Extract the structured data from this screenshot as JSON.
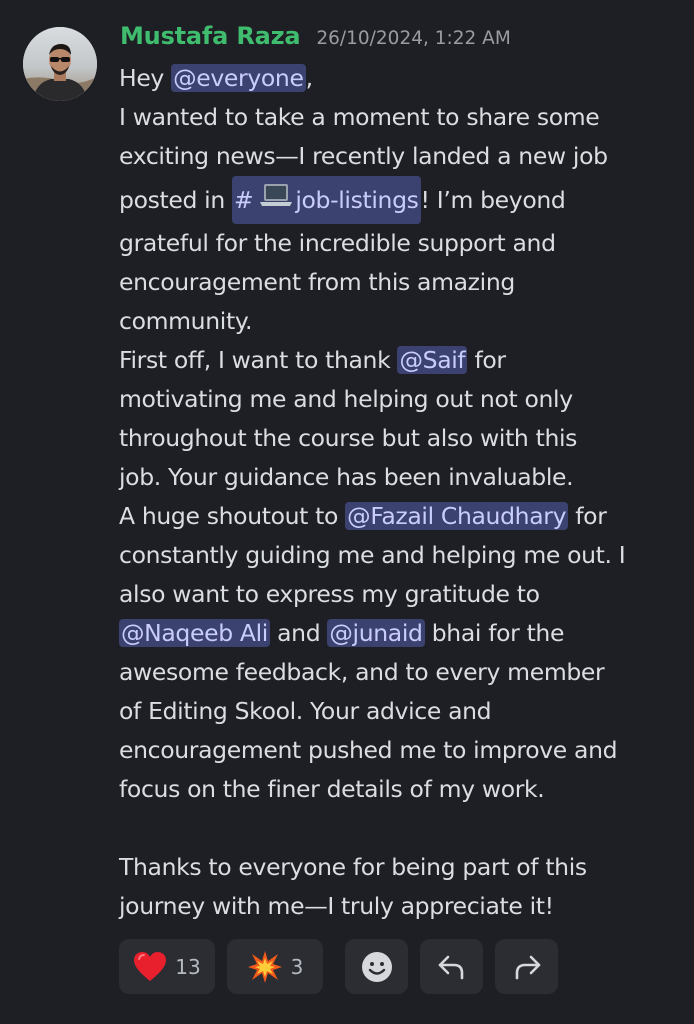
{
  "message": {
    "author": "Mustafa Raza",
    "timestamp": "26/10/2024, 1:22 AM",
    "author_color": "#3fbc6d",
    "lines": {
      "l1_pre": "Hey ",
      "l1_mention": "@everyone",
      "l1_post": ",",
      "l2": "I wanted to take a moment to share some",
      "l3": "exciting news—I recently landed a new job",
      "l4_pre": "posted in ",
      "l4_channel_hash": "#",
      "l4_channel_icon": "laptop-emoji",
      "l4_channel": "job-listings",
      "l4_post": "! I’m beyond",
      "l5": "grateful for the incredible support and",
      "l6": "encouragement from this amazing",
      "l7": "community.",
      "l8_pre": "First off, I want to thank ",
      "l8_mention": "@Saif",
      "l8_post": " for",
      "l9": "motivating me and helping out not only",
      "l10": "throughout the course but also with this",
      "l11": "job. Your guidance has been invaluable.",
      "l12_pre": "A huge shoutout to ",
      "l12_mention": "@Fazail Chaudhary",
      "l12_post": " for",
      "l13": "constantly guiding me and helping me out. I",
      "l14": "also want to express my gratitude to",
      "l15_mention1": "@Naqeeb Ali",
      "l15_mid": " and ",
      "l15_mention2": "@junaid",
      "l15_post": " bhai for the",
      "l16": "awesome feedback, and to every member",
      "l17": "of Editing Skool. Your advice and",
      "l18": "encouragement pushed me to improve and",
      "l19": "focus on the finer details of my work.",
      "l20": "Thanks to everyone for being part of this",
      "l21": "journey with me—I truly appreciate it!"
    }
  },
  "reactions": [
    {
      "emoji": "red-heart",
      "count": "13"
    },
    {
      "emoji": "collision",
      "count": "3"
    }
  ],
  "actions": [
    {
      "icon": "add-reaction-icon"
    },
    {
      "icon": "reply-icon"
    },
    {
      "icon": "forward-icon"
    }
  ],
  "colors": {
    "background": "#1e1f24",
    "text": "#dbdee1",
    "mention_bg": "#3c4270",
    "mention_text": "#c9cdfb",
    "reaction_bg": "#2b2d33"
  }
}
